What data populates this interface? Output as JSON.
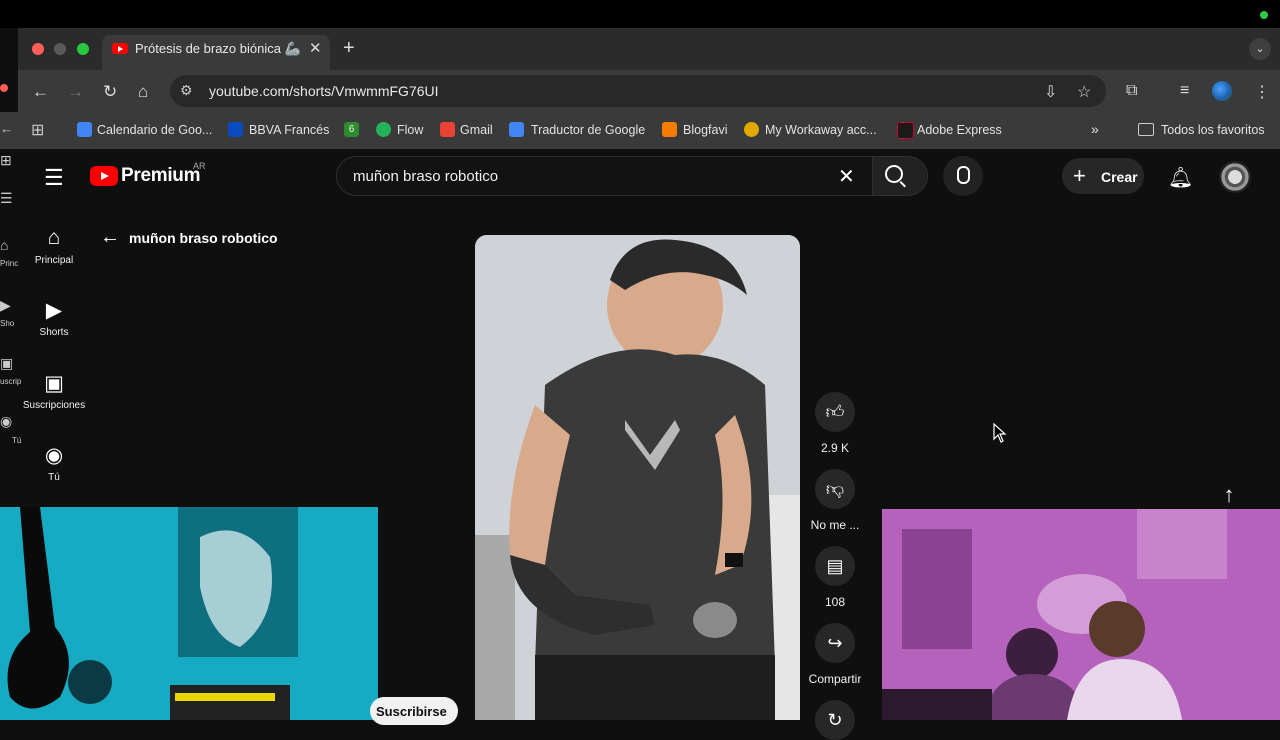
{
  "browser": {
    "tab_title": "Prótesis de brazo biónica 🦾",
    "url": "youtube.com/shorts/VmwmmFG76UI"
  },
  "bookmarks": [
    {
      "label": "Calendario de Goo...",
      "color": "#4285f4"
    },
    {
      "label": "BBVA Francés",
      "color": "#0a4bbf"
    },
    {
      "label": "6",
      "color": "#2e8b2e"
    },
    {
      "label": "Flow",
      "color": "#25b35a"
    },
    {
      "label": "Gmail",
      "color": "#ea4335"
    },
    {
      "label": "Traductor de Google",
      "color": "#4285f4"
    },
    {
      "label": "Blogfavi",
      "color": "#f57c00"
    },
    {
      "label": "My Workaway acc...",
      "color": "#e0a800"
    },
    {
      "label": "Adobe Express",
      "color": "#1a1a1a"
    }
  ],
  "bookmarks_more": "»",
  "all_bookmarks": "Todos los favoritos",
  "youtube": {
    "logo_text": "Premium",
    "country": "AR",
    "search_value": "muñon braso robotico",
    "create_label": "Crear",
    "sidebar": [
      {
        "label": "Principal",
        "icon": "home-icon"
      },
      {
        "label": "Shorts",
        "icon": "shorts-icon"
      },
      {
        "label": "Suscripciones",
        "icon": "subscriptions-icon"
      },
      {
        "label": "Tú",
        "icon": "you-icon"
      }
    ],
    "back_query": "muñon braso robotico",
    "actions": {
      "like_count": "2.9 K",
      "dislike_label": "No me ...",
      "comments_count": "108",
      "share_label": "Compartir"
    },
    "subscribe_label": "Suscribirse"
  },
  "ghost_sidebar": [
    "Princ",
    "Sho",
    "uscrip",
    "Tú"
  ],
  "colors": {
    "accent": "#ff0000",
    "background": "#0f0f0f"
  }
}
